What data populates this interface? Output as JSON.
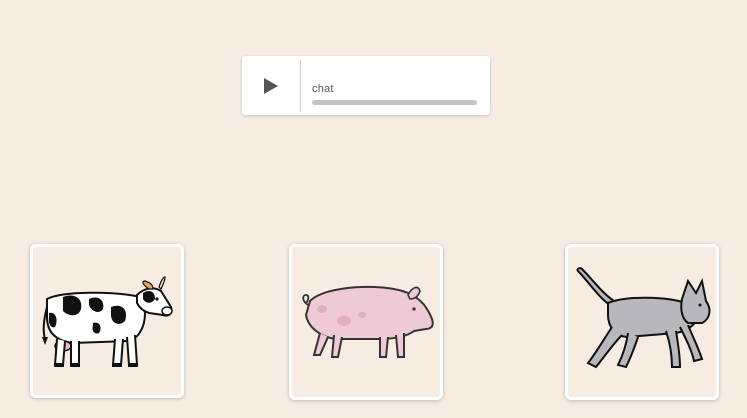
{
  "player": {
    "label": "chat",
    "progress": 0,
    "play_icon": "play-icon"
  },
  "choices": [
    {
      "animal": "cow",
      "icon": "cow-image"
    },
    {
      "animal": "pig",
      "icon": "pig-image"
    },
    {
      "animal": "cat",
      "icon": "cat-image"
    }
  ],
  "colors": {
    "background": "#f6ece2",
    "card_border": "#ffffff",
    "progress_track": "#c4c4c8"
  }
}
